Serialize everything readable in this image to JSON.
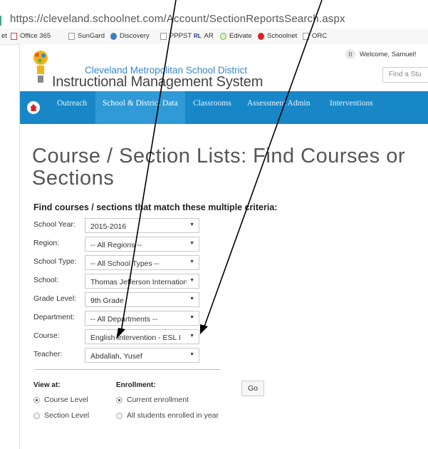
{
  "browser": {
    "url": "https://cleveland.schoolnet.com/Account/SectionReportsSearch.aspx",
    "bookmarks": [
      {
        "label": "et",
        "icon": "none"
      },
      {
        "label": "Office 365",
        "icon": "office365-icon"
      },
      {
        "label": "SunGard",
        "icon": "page-icon"
      },
      {
        "label": "Discovery",
        "icon": "globe-icon"
      },
      {
        "label": "PPPST",
        "icon": "page-icon"
      },
      {
        "label": "AR",
        "icon": "rl-icon"
      },
      {
        "label": "Edivate",
        "icon": "edivate-icon"
      },
      {
        "label": "Schoolnet",
        "icon": "schoolnet-icon"
      },
      {
        "label": "ORC",
        "icon": "page-icon"
      }
    ]
  },
  "header": {
    "district": "Cleveland Metropolitan School District",
    "system": "Instructional Management System",
    "notification_count": "0",
    "welcome": "Welcome, Samuel!",
    "search_placeholder": "Find a Stu"
  },
  "nav": {
    "items": [
      {
        "label": "Outreach",
        "active": false
      },
      {
        "label": "School & District Data",
        "active": true
      },
      {
        "label": "Classrooms",
        "active": false
      },
      {
        "label": "Assessment Admin",
        "active": false
      },
      {
        "label": "Interventions",
        "active": false
      }
    ]
  },
  "page": {
    "title": "Course / Section Lists: Find Courses or Sections",
    "subheading": "Find courses / sections that match these multiple criteria:"
  },
  "form": {
    "fields": [
      {
        "label": "School Year:",
        "value": "2015-2016"
      },
      {
        "label": "Region:",
        "value": "-- All Regions --"
      },
      {
        "label": "School Type:",
        "value": "-- All School Types --"
      },
      {
        "label": "School:",
        "value": "Thomas Jefferson Internation"
      },
      {
        "label": "Grade Level:",
        "value": "9th Grade"
      },
      {
        "label": "Department:",
        "value": "-- All Departments --"
      },
      {
        "label": "Course:",
        "value": "English Intervention - ESL I"
      },
      {
        "label": "Teacher:",
        "value": "Abdallah, Yusef"
      }
    ],
    "view_at": {
      "label": "View at:",
      "options": [
        {
          "label": "Course Level",
          "selected": true
        },
        {
          "label": "Section Level",
          "selected": false
        }
      ]
    },
    "enrollment": {
      "label": "Enrollment:",
      "options": [
        {
          "label": "Current enrollment",
          "selected": true
        },
        {
          "label": "All students enrolled in year",
          "selected": false
        }
      ]
    },
    "go_label": "Go"
  },
  "colors": {
    "nav_bg": "#1787c7",
    "nav_active": "#2f9ad6",
    "district_text": "#3a86c8"
  }
}
